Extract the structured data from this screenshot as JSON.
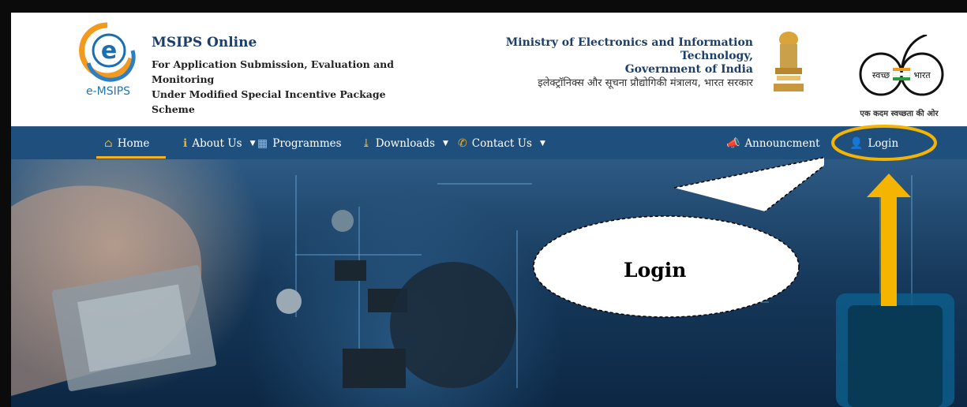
{
  "header": {
    "logo_text": "e-MSIPS",
    "title": "MSIPS Online",
    "subtitle_lines": [
      "For Application Submission, Evaluation and",
      "Monitoring",
      "Under Modified Special Incentive Package",
      "Scheme"
    ],
    "ministry_line1": "Ministry of Electronics and Information Technology,",
    "ministry_line2": "Government of India",
    "ministry_hindi": "इलेक्ट्रॉनिक्स और सूचना प्रौद्योगिकी मंत्रालय, भारत सरकार",
    "swachh_left": "स्वच्छ",
    "swachh_right": "भारत",
    "swachh_tagline": "एक कदम स्वच्छता की ओर"
  },
  "nav": {
    "home": "Home",
    "about": "About Us",
    "programmes": "Programmes",
    "downloads": "Downloads",
    "contact": "Contact Us",
    "announcement": "Announcment",
    "login": "Login"
  },
  "callout": {
    "label": "Login"
  },
  "colors": {
    "nav_bg": "#1f4f7c",
    "accent": "#f6b21b",
    "title": "#1b3e6a",
    "highlight": "#f5b400"
  },
  "icons": {
    "home": "home-icon",
    "about": "info-icon",
    "programmes": "calendar-icon",
    "downloads": "download-icon",
    "contact": "phone-icon",
    "announcement": "megaphone-icon",
    "login": "user-icon"
  }
}
